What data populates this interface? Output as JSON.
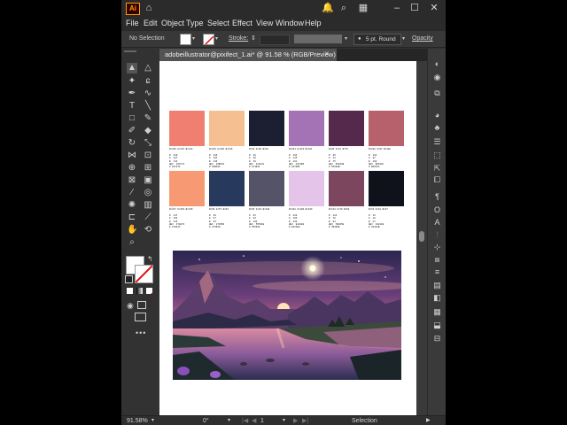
{
  "app": {
    "logo_text": "Ai",
    "menus": [
      "File",
      "Edit",
      "Object",
      "Type",
      "Select",
      "Effect",
      "View",
      "Window",
      "Help"
    ]
  },
  "titlebar": {
    "icons": [
      "home-icon",
      "bell-icon",
      "search-icon",
      "workspace-icon",
      "minimize-icon",
      "maximize-icon",
      "close-icon"
    ],
    "glyphs": [
      "⌂",
      "🔔",
      "⌕",
      "▦",
      "–",
      "☐",
      "✕"
    ]
  },
  "control": {
    "selection_label": "No Selection",
    "stroke_label": "Stroke:",
    "brush_label": "5 pt. Round",
    "opacity_label": "Opacity"
  },
  "document": {
    "tab_title": "adobeillustrator@pixifect_1.ai* @ 91.58 % (RGB/Preview)",
    "close_glyph": "✕"
  },
  "swatches": [
    {
      "color": "#f07f72",
      "info": "R=240 G=127 B=114\n\nR  240\nG  127\nB  114\nHEX  F07F72\n# F07F72"
    },
    {
      "color": "#f6bf92",
      "info": "R=246 G=191 B=146\n\nR  246\nG  191\nB  146\nHEX  F6BF92\n# F6BF92"
    },
    {
      "color": "#1c1e31",
      "info": "R=28 G=30 B=49\n\nR  28\nG  30\nB  49\nHEX  1C1E31\n# 1C1E31"
    },
    {
      "color": "#a473b5",
      "info": "R=164 G=115 B=181\n\nR  164\nG  115\nB  181\nHEX  A473B5\n# A473B5"
    },
    {
      "color": "#55294b",
      "info": "R=85 G=41 B=75\n\nR  85\nG  41\nB  75\nHEX  55294B\n# 55294B"
    },
    {
      "color": "#b6616c",
      "info": "R=182 G=97 B=108\n\nR  182\nG  97\nB  108\nHEX  B6616C\n# B6616C"
    },
    {
      "color": "#f79a73",
      "info": "R=247 G=154 B=115\n\nR  247\nG  154\nB  115\nHEX  F79A73\n# F79A73"
    },
    {
      "color": "#27395d",
      "info": "R=39 G=57 B=93\n\nR  39\nG  57\nB  93\nHEX  27395D\n# 27395D"
    },
    {
      "color": "#555368",
      "info": "R=85 G=83 B=104\n\nR  85\nG  83\nB  104\nHEX  555368\n# 555368"
    },
    {
      "color": "#e4c4e9",
      "info": "R=228 G=196 B=233\n\nR  228\nG  196\nB  233\nHEX  E4C4E9\n# E4C4E9"
    },
    {
      "color": "#7b465e",
      "info": "R=123 G=70 B=94\n\nR  123\nG  70\nB  94\nHEX  7B465E\n# 7B465E"
    },
    {
      "color": "#10121b",
      "info": "R=16 G=18 B=27\n\nR  16\nG  18\nB  27\nHEX  10121B\n# 10121B"
    }
  ],
  "tools": [
    {
      "name": "selection-tool-icon",
      "glyph": "▲"
    },
    {
      "name": "direct-selection-tool-icon",
      "glyph": "△"
    },
    {
      "name": "magic-wand-tool-icon",
      "glyph": "✦"
    },
    {
      "name": "lasso-tool-icon",
      "glyph": "ɕ"
    },
    {
      "name": "pen-tool-icon",
      "glyph": "✒"
    },
    {
      "name": "curvature-tool-icon",
      "glyph": "∿"
    },
    {
      "name": "type-tool-icon",
      "glyph": "T"
    },
    {
      "name": "line-tool-icon",
      "glyph": "╲"
    },
    {
      "name": "rectangle-tool-icon",
      "glyph": "□"
    },
    {
      "name": "paintbrush-tool-icon",
      "glyph": "✎"
    },
    {
      "name": "shaper-tool-icon",
      "glyph": "✐"
    },
    {
      "name": "eraser-tool-icon",
      "glyph": "◆"
    },
    {
      "name": "rotate-tool-icon",
      "glyph": "↻"
    },
    {
      "name": "scale-tool-icon",
      "glyph": "⤡"
    },
    {
      "name": "width-tool-icon",
      "glyph": "⋈"
    },
    {
      "name": "free-transform-tool-icon",
      "glyph": "⊡"
    },
    {
      "name": "shape-builder-tool-icon",
      "glyph": "⊕"
    },
    {
      "name": "perspective-grid-tool-icon",
      "glyph": "⊞"
    },
    {
      "name": "mesh-tool-icon",
      "glyph": "⊠"
    },
    {
      "name": "gradient-tool-icon",
      "glyph": "▣"
    },
    {
      "name": "eyedropper-tool-icon",
      "glyph": "⁄"
    },
    {
      "name": "blend-tool-icon",
      "glyph": "◎"
    },
    {
      "name": "symbol-sprayer-tool-icon",
      "glyph": "✺"
    },
    {
      "name": "column-graph-tool-icon",
      "glyph": "▥"
    },
    {
      "name": "artboard-tool-icon",
      "glyph": "⊏"
    },
    {
      "name": "slice-tool-icon",
      "glyph": "⟋"
    },
    {
      "name": "hand-tool-icon",
      "glyph": "✋"
    },
    {
      "name": "rotate-view-tool-icon",
      "glyph": "⟲"
    },
    {
      "name": "zoom-tool-icon",
      "glyph": "⌕"
    }
  ],
  "right_icons": [
    {
      "name": "properties-icon",
      "glyph": "◐"
    },
    {
      "name": "layers-icon",
      "glyph": "◉"
    },
    {
      "name": "libraries-icon",
      "glyph": "⧉"
    },
    {
      "name": "color-icon",
      "glyph": "◕"
    },
    {
      "name": "color-guide-icon",
      "glyph": "♣"
    },
    {
      "name": "brushes-icon",
      "glyph": "☰"
    },
    {
      "name": "symbols-icon",
      "glyph": "⬚"
    },
    {
      "name": "export-icon",
      "glyph": "⇱"
    },
    {
      "name": "graphic-styles-icon",
      "glyph": "⧠"
    },
    {
      "name": "paragraph-icon",
      "glyph": "¶"
    },
    {
      "name": "opentype-icon",
      "glyph": "O"
    },
    {
      "name": "character-icon",
      "glyph": "A"
    },
    {
      "name": "align-icon",
      "glyph": "⫶"
    },
    {
      "name": "transform-icon",
      "glyph": "⊹"
    },
    {
      "name": "pathfinder-icon",
      "glyph": "⧇"
    },
    {
      "name": "stroke-icon",
      "glyph": "≡"
    },
    {
      "name": "gradient-icon",
      "glyph": "▤"
    },
    {
      "name": "transparency-icon",
      "glyph": "◧"
    },
    {
      "name": "appearance-icon",
      "glyph": "▦"
    },
    {
      "name": "asset-export-icon",
      "glyph": "⬓"
    },
    {
      "name": "links-icon",
      "glyph": "⊟"
    }
  ],
  "status": {
    "zoom": "91.58%",
    "rotation": "0°",
    "artboard_number": "1",
    "tool_name": "Selection"
  }
}
